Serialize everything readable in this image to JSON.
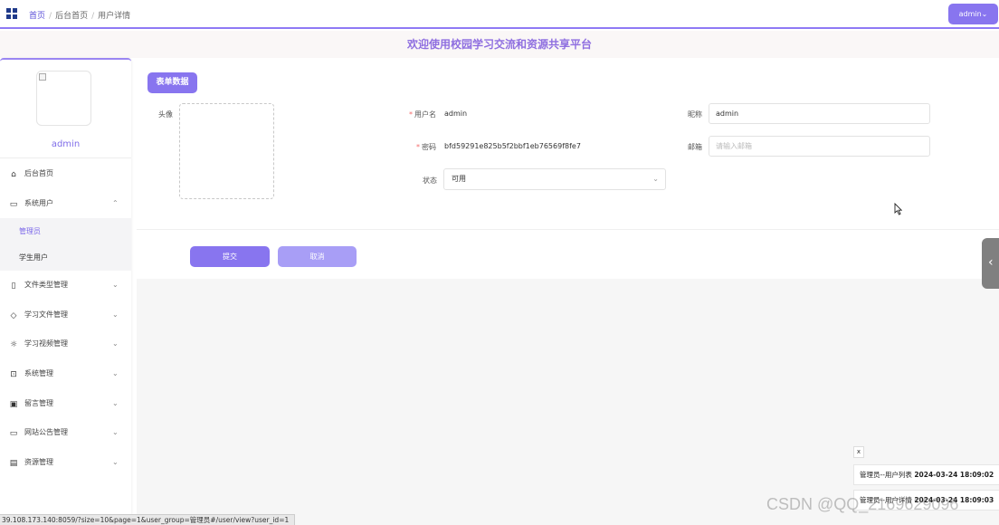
{
  "topbar": {
    "breadcrumbs": [
      "首页",
      "后台首页",
      "用户详情"
    ],
    "breadcrumb_separator": "/",
    "user_button": "admin⌄"
  },
  "title": "欢迎使用校园学习交流和资源共享平台",
  "sidebar": {
    "username": "admin",
    "items": [
      {
        "label": "后台首页",
        "icon": "home-icon"
      },
      {
        "label": "系统用户",
        "icon": "monitor-icon",
        "expanded": true
      },
      {
        "label": "文件类型管理",
        "icon": "bookmark-icon"
      },
      {
        "label": "学习文件管理",
        "icon": "tag-icon"
      },
      {
        "label": "学习视频管理",
        "icon": "sun-icon"
      },
      {
        "label": "系统管理",
        "icon": "inbox-icon"
      },
      {
        "label": "留言管理",
        "icon": "clipboard-icon"
      },
      {
        "label": "网站公告管理",
        "icon": "chat-icon"
      },
      {
        "label": "资源管理",
        "icon": "archive-icon"
      }
    ],
    "subitems": [
      "管理员",
      "学生用户"
    ],
    "chevron_up": "⌃",
    "chevron_down": "⌄"
  },
  "form": {
    "badge": "表单数据",
    "avatar_label": "头像",
    "username_label": "用户名",
    "username_value": "admin",
    "password_label": "密码",
    "password_value": "bfd59291e825b5f2bbf1eb76569f8fe7",
    "status_label": "状态",
    "status_value": "可用",
    "nickname_label": "昵称",
    "nickname_value": "admin",
    "email_label": "邮箱",
    "email_placeholder": "请输入邮箱",
    "required_mark": "*",
    "submit": "提交",
    "cancel": "取消"
  },
  "notifications": {
    "close": "x",
    "items": [
      {
        "title": "管理员--用户列表",
        "time": "2024-03-24 18:09:02"
      },
      {
        "title": "管理员--用户详情",
        "time": "2024-03-24 18:09:03"
      }
    ]
  },
  "watermark": "CSDN @QQ_2169629096",
  "status_url": "39.108.173.140:8059/?size=10&page=1&user_group=管理员#/user/view?user_id=1",
  "colors": {
    "accent": "#8875ef",
    "title": "#8f6fe0",
    "required": "#f56c6c"
  }
}
